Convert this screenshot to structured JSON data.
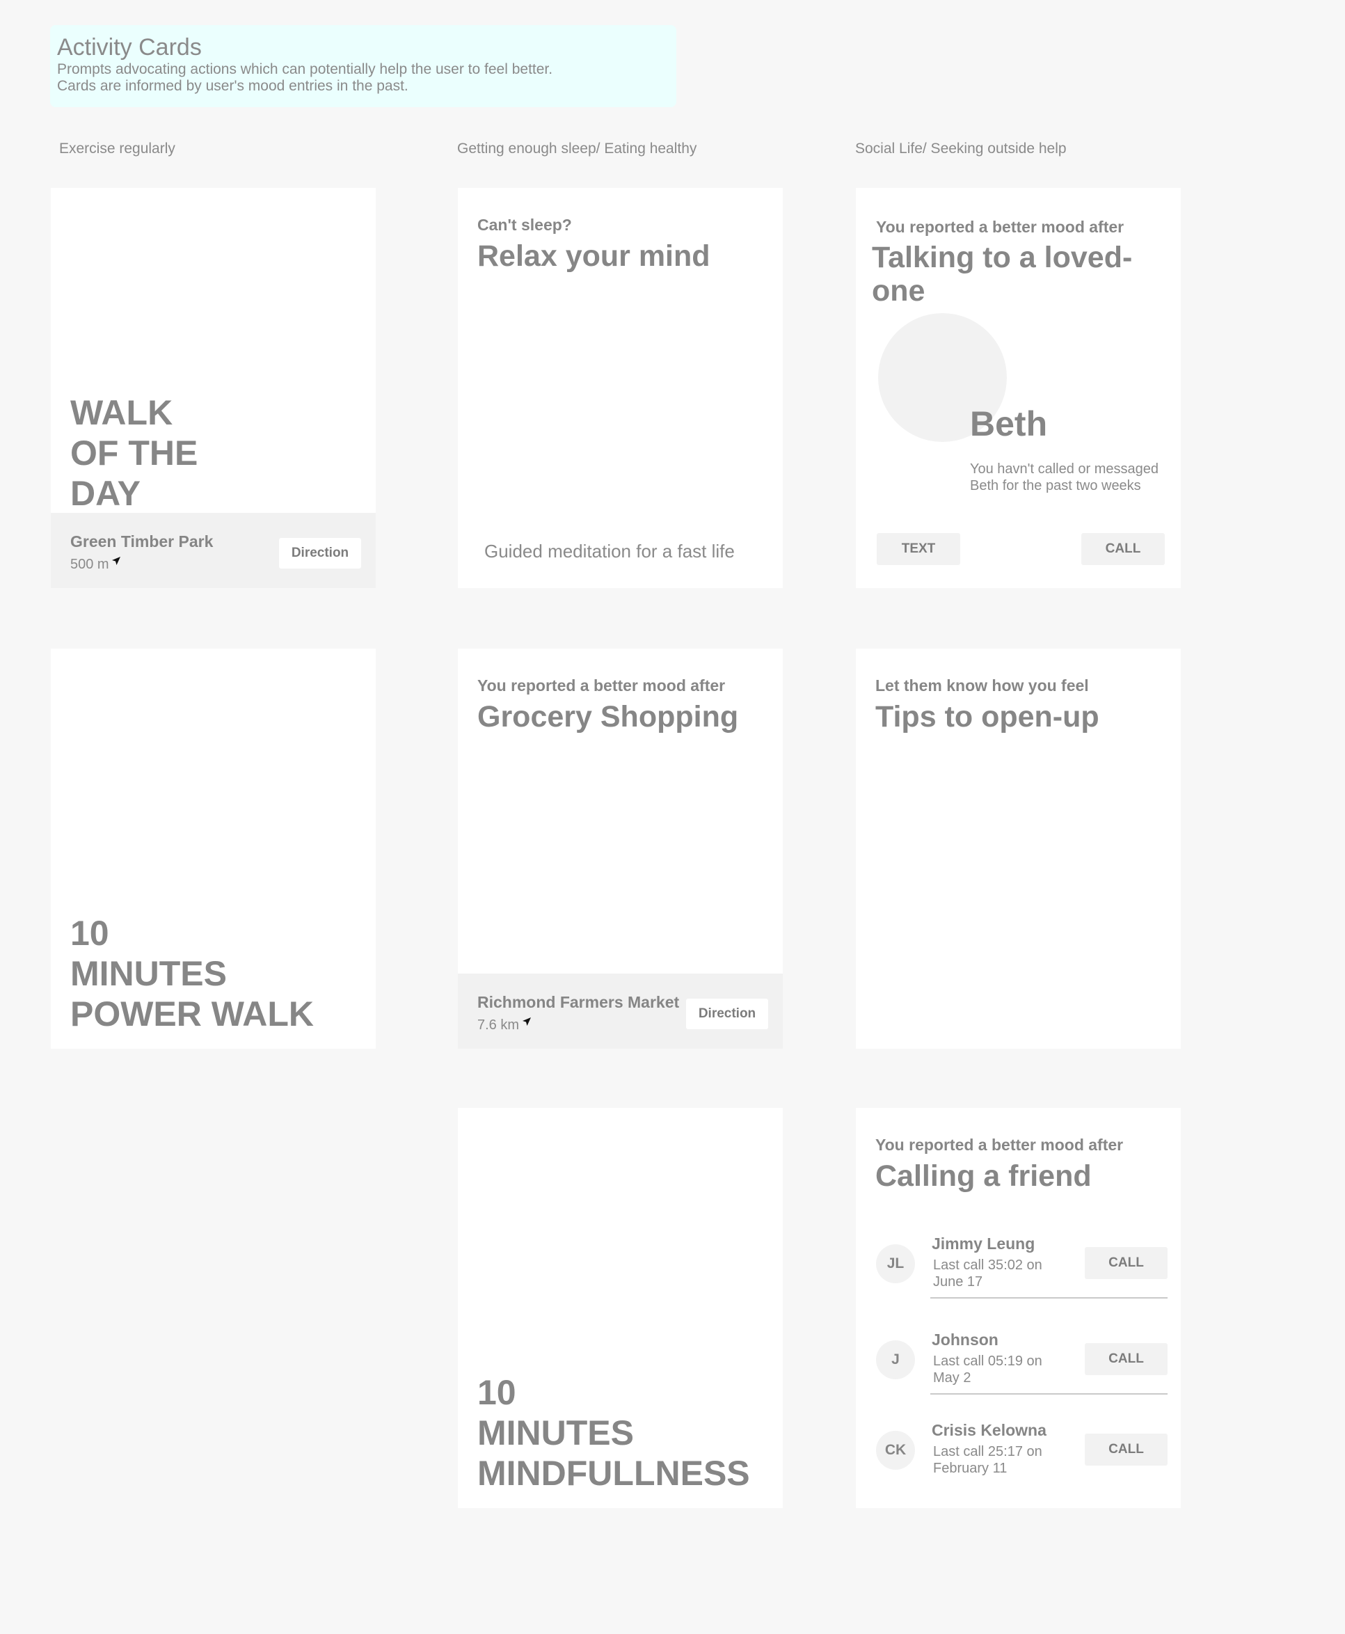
{
  "header": {
    "title": "Activity Cards",
    "desc_line1": "Prompts advocating actions which can potentially help the user to feel better.",
    "desc_line2": "Cards are informed by user's mood entries in the past."
  },
  "columns": [
    "Exercise regularly",
    "Getting enough sleep/ Eating healthy",
    "Social Life/ Seeking outside help"
  ],
  "walk_card": {
    "title_line1": "WALK",
    "title_line2": "OF THE",
    "title_line3": "DAY",
    "place": "Green Timber Park",
    "distance": "500 m",
    "button": "Direction"
  },
  "relax_card": {
    "kicker": "Can't sleep?",
    "title": "Relax your mind",
    "caption": "Guided meditation for a fast life"
  },
  "loved_one_card": {
    "kicker": "You reported a better mood after",
    "title_line1": "Talking to a loved-",
    "title_line2": "one",
    "name": "Beth",
    "message": "You havn't called or messaged Beth for the past two weeks",
    "text_button": "TEXT",
    "call_button": "CALL"
  },
  "power_walk_card": {
    "line1": "10",
    "line2": "MINUTES",
    "line3": "POWER WALK"
  },
  "grocery_card": {
    "kicker": "You reported a better mood after",
    "title": "Grocery Shopping",
    "place": "Richmond Farmers Market",
    "distance": "7.6 km",
    "button": "Direction"
  },
  "tips_card": {
    "kicker": "Let them know how you feel",
    "title": "Tips to open-up"
  },
  "mindfulness_card": {
    "line1": "10",
    "line2": "MINUTES",
    "line3": "MINDFULLNESS"
  },
  "friend_card": {
    "kicker": "You reported a better mood after",
    "title": "Calling a friend",
    "contacts": [
      {
        "initials": "JL",
        "name": "Jimmy Leung",
        "last_call": "Last call 35:02 on June 17",
        "button": "CALL"
      },
      {
        "initials": "J",
        "name": "Johnson",
        "last_call": "Last call 05:19 on May 2",
        "button": "CALL"
      },
      {
        "initials": "CK",
        "name": "Crisis Kelowna",
        "last_call": "Last call 25:17 on February 11",
        "button": "CALL"
      }
    ]
  }
}
